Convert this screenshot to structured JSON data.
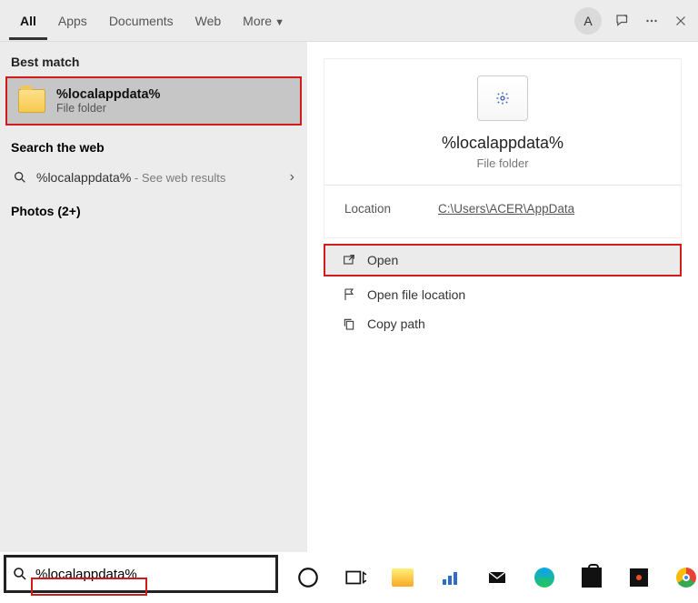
{
  "tabs": {
    "all": "All",
    "apps": "Apps",
    "documents": "Documents",
    "web": "Web",
    "more": "More"
  },
  "avatar": "A",
  "bestMatch": {
    "label": "Best match",
    "title": "%localappdata%",
    "subtitle": "File folder"
  },
  "searchWeb": {
    "label": "Search the web",
    "query": "%localappdata%",
    "hint": " - See web results"
  },
  "photos": {
    "label": "Photos (2+)"
  },
  "preview": {
    "title": "%localappdata%",
    "subtitle": "File folder",
    "locationLabel": "Location",
    "locationPath": "C:\\Users\\ACER\\AppData"
  },
  "actions": {
    "open": "Open",
    "openLocation": "Open file location",
    "copyPath": "Copy path"
  },
  "searchInput": "%localappdata%"
}
